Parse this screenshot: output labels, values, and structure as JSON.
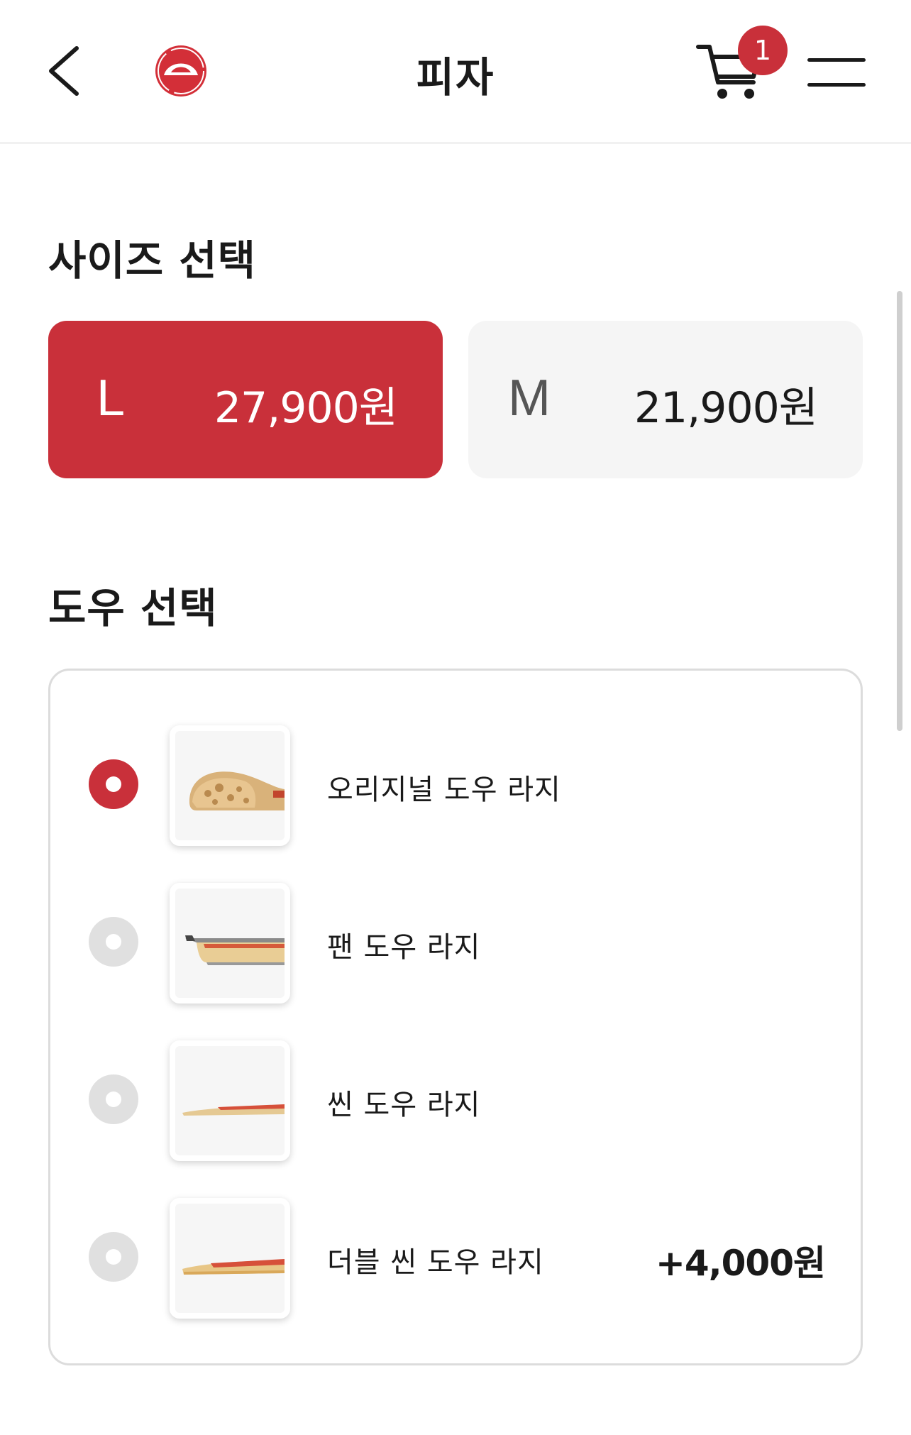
{
  "header": {
    "title": "피자",
    "cart_count": "1",
    "back_icon": "chevron-left-icon",
    "logo": "pizza-hut-logo",
    "cart_icon": "shopping-cart-icon",
    "menu_icon": "hamburger-menu-icon"
  },
  "size_section": {
    "title": "사이즈 선택",
    "options": [
      {
        "size": "L",
        "price": "27,900원",
        "selected": true
      },
      {
        "size": "M",
        "price": "21,900원",
        "selected": false
      }
    ]
  },
  "dough_section": {
    "title": "도우 선택",
    "options": [
      {
        "label": "오리지널 도우 라지",
        "extra": "",
        "selected": true
      },
      {
        "label": "팬 도우 라지",
        "extra": "",
        "selected": false
      },
      {
        "label": "씬 도우 라지",
        "extra": "",
        "selected": false
      },
      {
        "label": "더블 씬 도우 라지",
        "extra": "+4,000원",
        "selected": false
      }
    ]
  },
  "colors": {
    "accent": "#c9303a",
    "inactive_card": "#f5f5f5",
    "radio_off": "#e0e0e0"
  }
}
